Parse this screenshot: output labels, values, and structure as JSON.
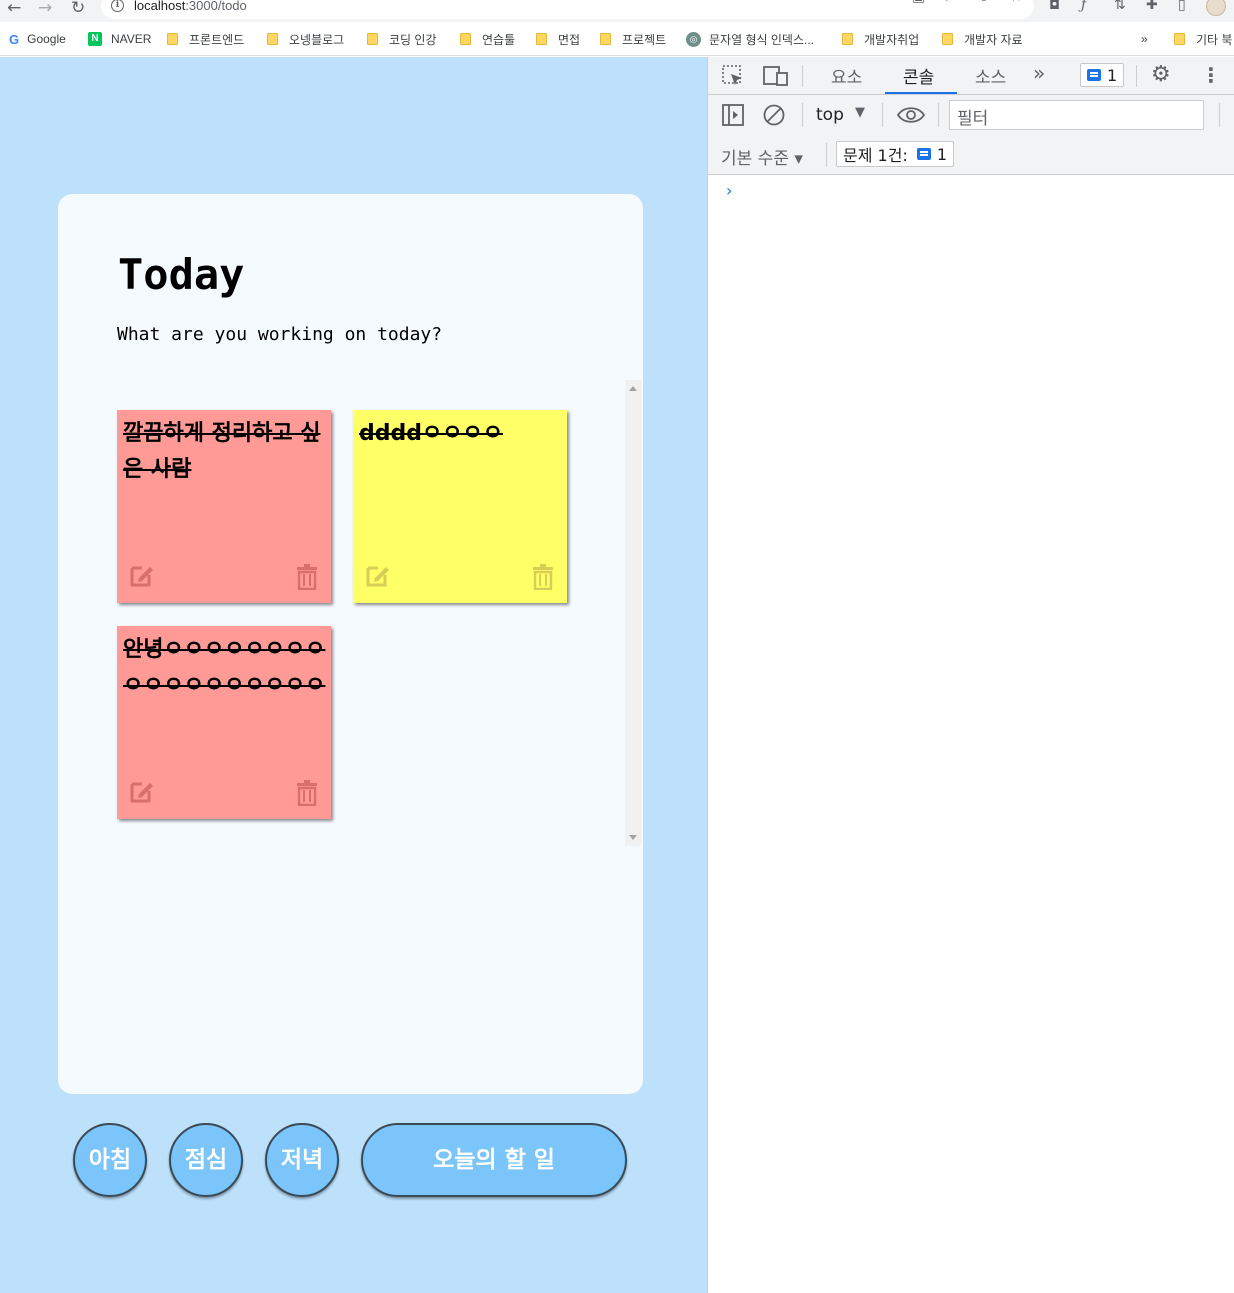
{
  "browser": {
    "url_host": "localhost",
    "url_path": ":3000/todo",
    "back_glyph": "←",
    "forward_glyph": "→",
    "reload_glyph": "↻",
    "bookmarks": [
      {
        "label": "Google",
        "icon": "google-icon"
      },
      {
        "label": "NAVER",
        "icon": "naver-icon"
      },
      {
        "label": "프론트엔드",
        "icon": "folder-icon"
      },
      {
        "label": "오넹블로그",
        "icon": "folder-icon"
      },
      {
        "label": "코딩 인강",
        "icon": "folder-icon"
      },
      {
        "label": "연습툴",
        "icon": "folder-icon"
      },
      {
        "label": "면접",
        "icon": "folder-icon"
      },
      {
        "label": "프로젝트",
        "icon": "folder-icon"
      },
      {
        "label": "문자열 형식 인덱스...",
        "icon": "openai-icon"
      },
      {
        "label": "개발자취업",
        "icon": "folder-icon"
      },
      {
        "label": "개발자 자료",
        "icon": "folder-icon"
      }
    ],
    "overflow_label": "»",
    "other_bookmarks_label": "기타 북"
  },
  "app": {
    "title": "Today",
    "subtitle": "What are you working on today?",
    "notes": [
      {
        "text": "깔끔하게 정리하고 싶은 사람",
        "color": "#ff9a96"
      },
      {
        "text": "ddddㅇㅇㅇㅇ",
        "color": "#ffff66"
      },
      {
        "text": "안녕ㅇㅇㅇㅇㅇㅇㅇㅇㅇㅇㅇㅇㅇㅇㅇㅇㅇㅇ",
        "color": "#ff9a96"
      }
    ],
    "buttons": {
      "morning": "아침",
      "lunch": "점심",
      "dinner": "저녁",
      "today": "오늘의 할 일"
    },
    "colors": {
      "background": "#bde0fb",
      "card": "#f5faff",
      "button": "#7cc5fa"
    }
  },
  "devtools": {
    "tabs": {
      "elements": "요소",
      "console": "콘솔",
      "sources": "소스"
    },
    "active_tab": "콘솔",
    "issues_count": "1",
    "context": "top",
    "filter_placeholder": "필터",
    "log_level": "기본 수준",
    "issues_label": "문제 1건:",
    "issues_badge_count": "1",
    "prompt_glyph": "›"
  }
}
